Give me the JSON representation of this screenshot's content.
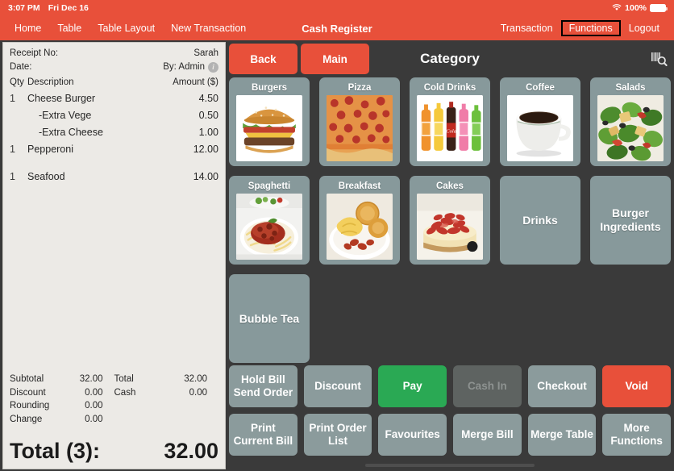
{
  "status_bar": {
    "time": "3:07 PM",
    "date": "Fri Dec 16",
    "battery_percent": "100%",
    "wifi_icon": "wifi-icon",
    "battery_icon": "battery-icon"
  },
  "nav": {
    "title": "Cash Register",
    "left_items": [
      {
        "label": "Home",
        "name": "nav-home"
      },
      {
        "label": "Table",
        "name": "nav-table"
      },
      {
        "label": "Table Layout",
        "name": "nav-table-layout"
      },
      {
        "label": "New Transaction",
        "name": "nav-new-transaction"
      }
    ],
    "right_items": [
      {
        "label": "Transaction",
        "name": "nav-transaction",
        "highlighted": false
      },
      {
        "label": "Functions",
        "name": "nav-functions",
        "highlighted": true
      },
      {
        "label": "Logout",
        "name": "nav-logout",
        "highlighted": false
      }
    ]
  },
  "receipt": {
    "receipt_no_label": "Receipt No:",
    "receipt_no_value": "Sarah",
    "date_label": "Date:",
    "date_value": "By: Admin",
    "info_icon": "info-icon",
    "columns": {
      "qty": "Qty",
      "description": "Description",
      "amount": "Amount ($)"
    },
    "items": [
      {
        "qty": "1",
        "description": "Cheese Burger",
        "amount": "4.50",
        "modifier": false,
        "gap": false
      },
      {
        "qty": "",
        "description": "-Extra Vege",
        "amount": "0.50",
        "modifier": true,
        "gap": false
      },
      {
        "qty": "",
        "description": "-Extra Cheese",
        "amount": "1.00",
        "modifier": true,
        "gap": false
      },
      {
        "qty": "1",
        "description": "Pepperoni",
        "amount": "12.00",
        "modifier": false,
        "gap": false
      },
      {
        "qty": "1",
        "description": "Seafood",
        "amount": "14.00",
        "modifier": false,
        "gap": true
      }
    ],
    "totals_left": [
      {
        "label": "Subtotal",
        "value": "32.00"
      },
      {
        "label": "Discount",
        "value": "0.00"
      },
      {
        "label": "Rounding",
        "value": "0.00"
      },
      {
        "label": "Change",
        "value": "0.00"
      }
    ],
    "totals_right": [
      {
        "label": "Total",
        "value": "32.00"
      },
      {
        "label": "Cash",
        "value": "0.00"
      }
    ],
    "grand_total_label": "Total (3):",
    "grand_total_value": "32.00"
  },
  "category_toolbar": {
    "back_label": "Back",
    "main_label": "Main",
    "title": "Category",
    "barcode_icon": "barcode-search-icon"
  },
  "categories": [
    {
      "label": "Burgers",
      "image": "burger",
      "name": "category-burgers"
    },
    {
      "label": "Pizza",
      "image": "pizza",
      "name": "category-pizza"
    },
    {
      "label": "Cold Drinks",
      "image": "cold-drinks",
      "name": "category-cold-drinks"
    },
    {
      "label": "Coffee",
      "image": "coffee",
      "name": "category-coffee"
    },
    {
      "label": "Salads",
      "image": "salad",
      "name": "category-salads"
    },
    {
      "label": "Spaghetti",
      "image": "spaghetti",
      "name": "category-spaghetti"
    },
    {
      "label": "Breakfast",
      "image": "breakfast",
      "name": "category-breakfast"
    },
    {
      "label": "Cakes",
      "image": "cake",
      "name": "category-cakes"
    },
    {
      "label": "Drinks",
      "image": null,
      "name": "category-drinks"
    },
    {
      "label": "Burger Ingredients",
      "image": null,
      "name": "category-burger-ingredients"
    },
    {
      "label": "Bubble Tea",
      "image": null,
      "name": "category-bubble-tea"
    }
  ],
  "actions_row1": [
    {
      "label": "Hold Bill\nSend Order",
      "style": "default",
      "name": "hold-bill-send-order-button"
    },
    {
      "label": "Discount",
      "style": "default",
      "name": "discount-button"
    },
    {
      "label": "Pay",
      "style": "pay",
      "name": "pay-button"
    },
    {
      "label": "Cash In",
      "style": "disabled",
      "name": "cash-in-button"
    },
    {
      "label": "Checkout",
      "style": "default",
      "name": "checkout-button"
    },
    {
      "label": "Void",
      "style": "void",
      "name": "void-button"
    }
  ],
  "actions_row2": [
    {
      "label": "Print\nCurrent Bill",
      "style": "default",
      "name": "print-current-bill-button"
    },
    {
      "label": "Print Order\nList",
      "style": "default",
      "name": "print-order-list-button"
    },
    {
      "label": "Favourites",
      "style": "default",
      "name": "favourites-button"
    },
    {
      "label": "Merge Bill",
      "style": "default",
      "name": "merge-bill-button"
    },
    {
      "label": "Merge Table",
      "style": "default",
      "name": "merge-table-button"
    },
    {
      "label": "More\nFunctions",
      "style": "default",
      "name": "more-functions-button"
    }
  ],
  "colors": {
    "brand_red": "#e8503a",
    "tile_gray": "#87999b",
    "pay_green": "#2aa954",
    "background_dark": "#3a3a3a",
    "receipt_paper": "#eceae6"
  }
}
